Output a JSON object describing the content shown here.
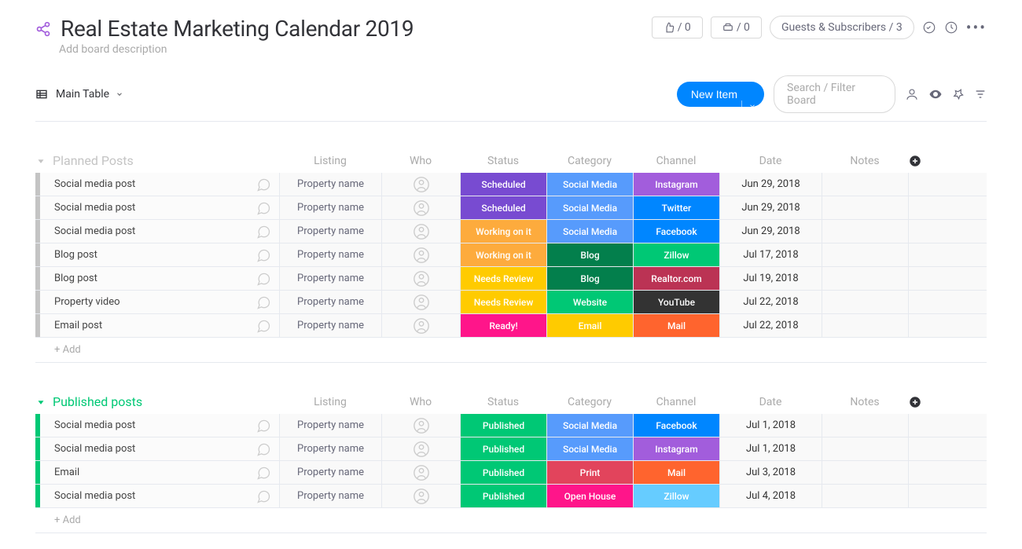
{
  "header": {
    "title": "Real Estate Marketing Calendar 2019",
    "subtitle": "Add board description",
    "guests": "Guests & Subscribers / 3",
    "badge1": "/ 0",
    "badge2": "/ 0"
  },
  "viewbar": {
    "view": "Main Table",
    "newItem": "New Item",
    "searchPlaceholder": "Search / Filter Board"
  },
  "columns": [
    "Listing",
    "Who",
    "Status",
    "Category",
    "Channel",
    "Date",
    "Notes"
  ],
  "addRow": "+ Add",
  "groups": [
    {
      "title": "Planned Posts",
      "color": "#c4c4c4",
      "barColor": "#c4c4c4",
      "rows": [
        {
          "name": "Social media post",
          "listing": "Property name",
          "status": {
            "t": "Scheduled",
            "c": "#784bd1"
          },
          "category": {
            "t": "Social Media",
            "c": "#579bfc"
          },
          "channel": {
            "t": "Instagram",
            "c": "#a25ddc"
          },
          "date": "Jun 29, 2018"
        },
        {
          "name": "Social media post",
          "listing": "Property name",
          "status": {
            "t": "Scheduled",
            "c": "#784bd1"
          },
          "category": {
            "t": "Social Media",
            "c": "#579bfc"
          },
          "channel": {
            "t": "Twitter",
            "c": "#0086ff"
          },
          "date": "Jun 29, 2018"
        },
        {
          "name": "Social media post",
          "listing": "Property name",
          "status": {
            "t": "Working on it",
            "c": "#fdab3d"
          },
          "category": {
            "t": "Social Media",
            "c": "#579bfc"
          },
          "channel": {
            "t": "Facebook",
            "c": "#0086ff"
          },
          "date": "Jun 29, 2018"
        },
        {
          "name": "Blog post",
          "listing": "Property name",
          "status": {
            "t": "Working on it",
            "c": "#fdab3d"
          },
          "category": {
            "t": "Blog",
            "c": "#037f4c"
          },
          "channel": {
            "t": "Zillow",
            "c": "#00c875"
          },
          "date": "Jul 17, 2018"
        },
        {
          "name": "Blog post",
          "listing": "Property name",
          "status": {
            "t": "Needs Review",
            "c": "#ffcb00"
          },
          "category": {
            "t": "Blog",
            "c": "#037f4c"
          },
          "channel": {
            "t": "Realtor.com",
            "c": "#bb3354"
          },
          "date": "Jul 19, 2018"
        },
        {
          "name": "Property video",
          "listing": "Property name",
          "status": {
            "t": "Needs Review",
            "c": "#ffcb00"
          },
          "category": {
            "t": "Website",
            "c": "#00c875"
          },
          "channel": {
            "t": "YouTube",
            "c": "#333333"
          },
          "date": "Jul 22, 2018"
        },
        {
          "name": "Email post",
          "listing": "Property name",
          "status": {
            "t": "Ready!",
            "c": "#ff158a"
          },
          "category": {
            "t": "Email",
            "c": "#ffcb00"
          },
          "channel": {
            "t": "Mail",
            "c": "#ff642e"
          },
          "date": "Jul 22, 2018"
        }
      ]
    },
    {
      "title": "Published posts",
      "color": "#00c875",
      "barColor": "#00c875",
      "rows": [
        {
          "name": "Social media post",
          "listing": "Property name",
          "status": {
            "t": "Published",
            "c": "#00c875"
          },
          "category": {
            "t": "Social Media",
            "c": "#579bfc"
          },
          "channel": {
            "t": "Facebook",
            "c": "#0086ff"
          },
          "date": "Jul 1, 2018"
        },
        {
          "name": "Social media post",
          "listing": "Property name",
          "status": {
            "t": "Published",
            "c": "#00c875"
          },
          "category": {
            "t": "Social Media",
            "c": "#579bfc"
          },
          "channel": {
            "t": "Instagram",
            "c": "#a25ddc"
          },
          "date": "Jul 1, 2018"
        },
        {
          "name": "Email",
          "listing": "Property name",
          "status": {
            "t": "Published",
            "c": "#00c875"
          },
          "category": {
            "t": "Print",
            "c": "#e2445c"
          },
          "channel": {
            "t": "Mail",
            "c": "#ff642e"
          },
          "date": "Jul 3, 2018"
        },
        {
          "name": "Social media post",
          "listing": "Property name",
          "status": {
            "t": "Published",
            "c": "#00c875"
          },
          "category": {
            "t": "Open House",
            "c": "#ff158a"
          },
          "channel": {
            "t": "Zillow",
            "c": "#66ccff"
          },
          "date": "Jul 4, 2018"
        }
      ]
    }
  ]
}
